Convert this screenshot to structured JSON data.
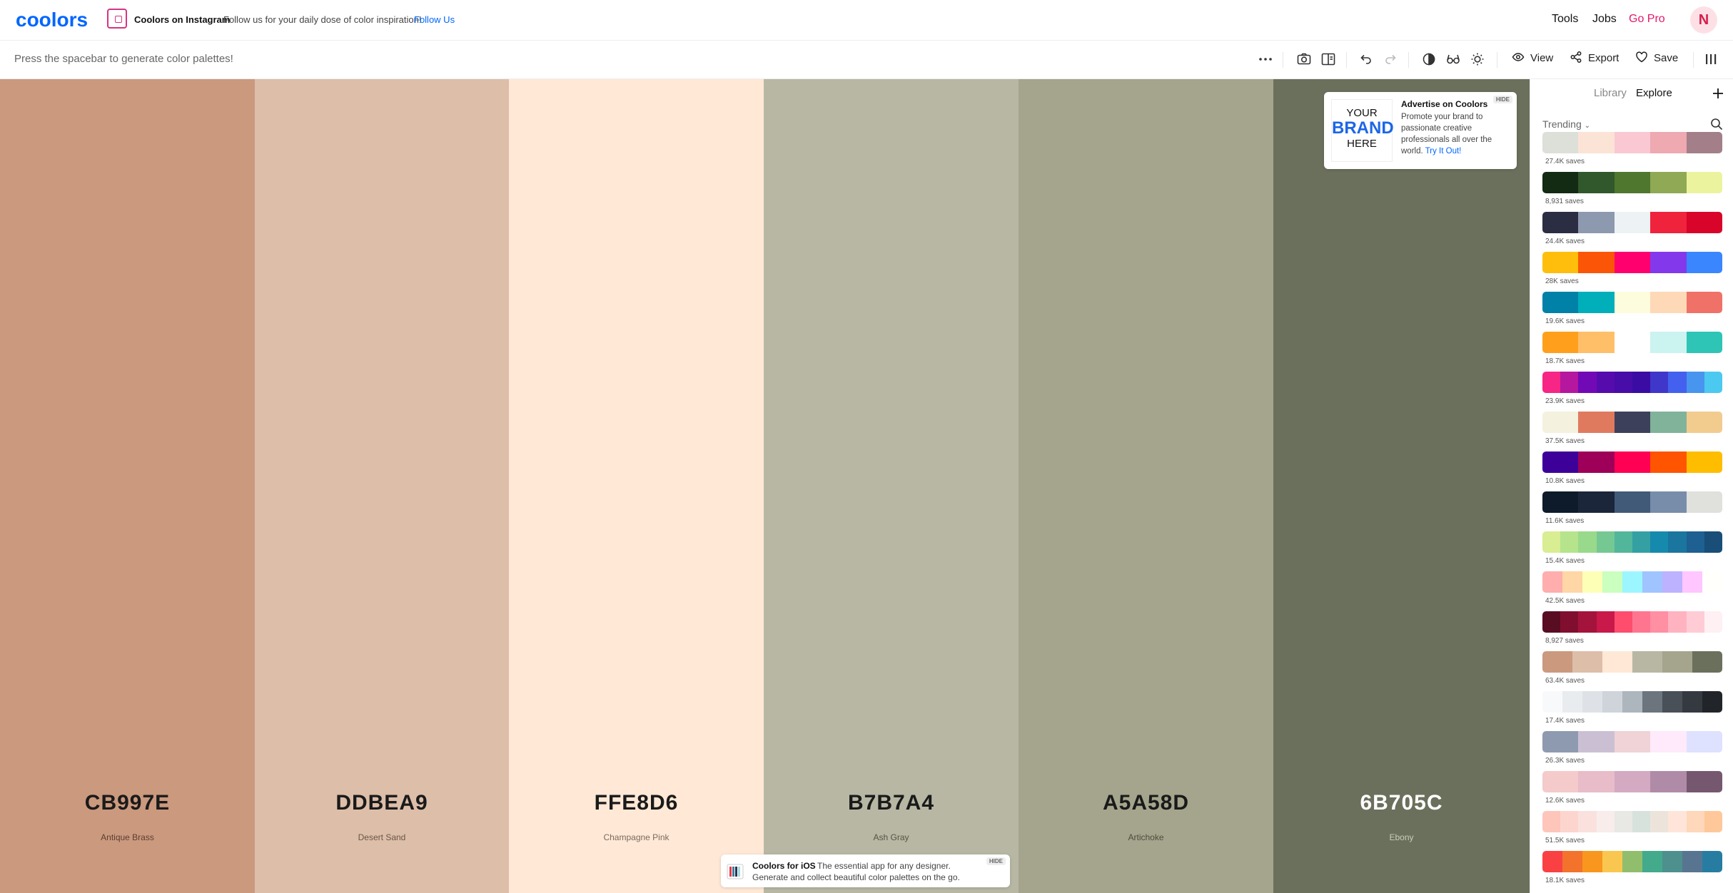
{
  "topnav": {
    "logo": "coolors",
    "promo_title": "Coolors on Instagram",
    "promo_text": "Follow us for your daily dose of color inspiration!",
    "promo_link": "Follow Us",
    "links": [
      "Tools",
      "Jobs",
      "Go Pro"
    ],
    "avatar_initial": "N"
  },
  "toolbar": {
    "hint": "Press the spacebar to generate color palettes!",
    "icons": [
      "more-icon",
      "camera-icon",
      "layout-icon",
      "undo-icon",
      "redo-icon",
      "contrast-icon",
      "glasses-icon",
      "brightness-icon"
    ],
    "view_label": "View",
    "export_label": "Export",
    "save_label": "Save"
  },
  "palette": [
    {
      "hex": "CB997E",
      "name": "Antique Brass",
      "color": "#CB997E",
      "text": "#1a1a1a",
      "sub": "#5a3f30"
    },
    {
      "hex": "DDBEA9",
      "name": "Desert Sand",
      "color": "#DDBEA9",
      "text": "#1a1a1a",
      "sub": "#6a5646"
    },
    {
      "hex": "FFE8D6",
      "name": "Champagne Pink",
      "color": "#FFE8D6",
      "text": "#1a1a1a",
      "sub": "#7a6a5e"
    },
    {
      "hex": "B7B7A4",
      "name": "Ash Gray",
      "color": "#B7B7A4",
      "text": "#1a1a1a",
      "sub": "#545446"
    },
    {
      "hex": "A5A58D",
      "name": "Artichoke",
      "color": "#A5A58D",
      "text": "#1a1a1a",
      "sub": "#4c4c3c"
    },
    {
      "hex": "6B705C",
      "name": "Ebony",
      "color": "#6B705C",
      "text": "#ffffff",
      "sub": "#c9cdbd"
    }
  ],
  "ad": {
    "hide": "HIDE",
    "brand_line1": "YOUR",
    "brand_line2": "BRAND",
    "brand_line3": "HERE",
    "title": "Advertise on Coolors",
    "body": "Promote your brand to passionate creative professionals all over the world.",
    "link": "Try It Out!"
  },
  "ios_banner": {
    "title": "Coolors for iOS",
    "sub": "The essential app for any designer.",
    "sub2": "Generate and collect beautiful color palettes on the go.",
    "hide": "HIDE"
  },
  "sidebar": {
    "tabs": [
      "Library",
      "Explore"
    ],
    "sort": "Trending",
    "palettes": [
      {
        "saves": "27.4K saves",
        "colors": [
          "#DCE0D9",
          "#FBE3D6",
          "#F9C8D2",
          "#EEA9B1",
          "#A27F89"
        ]
      },
      {
        "saves": "8,931 saves",
        "colors": [
          "#132A13",
          "#31572C",
          "#4F772D",
          "#90A955",
          "#ECF39E"
        ]
      },
      {
        "saves": "24.4K saves",
        "colors": [
          "#2B2D42",
          "#8D99AE",
          "#EDF2F4",
          "#EF233C",
          "#D90429"
        ]
      },
      {
        "saves": "28K saves",
        "colors": [
          "#FFBE0B",
          "#FB5607",
          "#FF006E",
          "#8338EC",
          "#3A86FF"
        ]
      },
      {
        "saves": "19.6K saves",
        "colors": [
          "#0081A7",
          "#00AFB9",
          "#FDFCDC",
          "#FED9B7",
          "#F07167"
        ]
      },
      {
        "saves": "18.7K saves",
        "colors": [
          "#FF9F1C",
          "#FFBF69",
          "#FFFFFF",
          "#CBF3F0",
          "#2EC4B6"
        ]
      },
      {
        "saves": "23.9K saves",
        "colors": [
          "#F72585",
          "#B5179E",
          "#7209B7",
          "#560BAD",
          "#480CA8",
          "#3A0CA3",
          "#3F37C9",
          "#4361EE",
          "#4895EF",
          "#4CC9F0"
        ]
      },
      {
        "saves": "37.5K saves",
        "colors": [
          "#F4F1DE",
          "#E07A5F",
          "#3D405B",
          "#81B29A",
          "#F2CC8F"
        ]
      },
      {
        "saves": "10.8K saves",
        "colors": [
          "#3D0099",
          "#9E0059",
          "#FF0054",
          "#FF5400",
          "#FFBD00"
        ]
      },
      {
        "saves": "11.6K saves",
        "colors": [
          "#0D1B2A",
          "#1B263B",
          "#415A77",
          "#778DA9",
          "#E0E1DD"
        ]
      },
      {
        "saves": "15.4K saves",
        "colors": [
          "#D9ED92",
          "#B5E48C",
          "#99D98C",
          "#76C893",
          "#52B69A",
          "#34A0A4",
          "#168AAD",
          "#1A759F",
          "#1E6091",
          "#184E77"
        ]
      },
      {
        "saves": "42.5K saves",
        "colors": [
          "#FFADAD",
          "#FFD6A5",
          "#FDFFB6",
          "#CAFFBF",
          "#9BF6FF",
          "#A0C4FF",
          "#BDB2FF",
          "#FFC6FF",
          "#FFFFFC"
        ]
      },
      {
        "saves": "8,927 saves",
        "colors": [
          "#590D22",
          "#800F2F",
          "#A4133C",
          "#C9184A",
          "#FF4D6D",
          "#FF758F",
          "#FF8FA3",
          "#FFB3C1",
          "#FFCCD5",
          "#FFF0F3"
        ]
      },
      {
        "saves": "63.4K saves",
        "colors": [
          "#CB997E",
          "#DDBEA9",
          "#FFE8D6",
          "#B7B7A4",
          "#A5A58D",
          "#6B705C"
        ]
      },
      {
        "saves": "17.4K saves",
        "colors": [
          "#F8F9FA",
          "#E9ECEF",
          "#DEE2E6",
          "#CED4DA",
          "#ADB5BD",
          "#6C757D",
          "#495057",
          "#343A40",
          "#212529"
        ]
      },
      {
        "saves": "26.3K saves",
        "colors": [
          "#8E9AAF",
          "#CBC0D3",
          "#EFD3D7",
          "#FEEAFA",
          "#DEE2FF"
        ]
      },
      {
        "saves": "12.6K saves",
        "colors": [
          "#F4CACA",
          "#E8BCC9",
          "#D3AAC2",
          "#B08BA8",
          "#75586F"
        ]
      },
      {
        "saves": "51.5K saves",
        "colors": [
          "#FEC5BB",
          "#FCD5CE",
          "#FAE1DD",
          "#F8EDEB",
          "#E8E8E4",
          "#D8E2DC",
          "#ECE4DB",
          "#FFE5D9",
          "#FFD7BA",
          "#FEC89A"
        ]
      },
      {
        "saves": "18.1K saves",
        "colors": [
          "#F94144",
          "#F3722C",
          "#F8961E",
          "#F9C74F",
          "#90BE6D",
          "#43AA8B",
          "#4D908E",
          "#577590",
          "#277DA1"
        ]
      }
    ]
  }
}
